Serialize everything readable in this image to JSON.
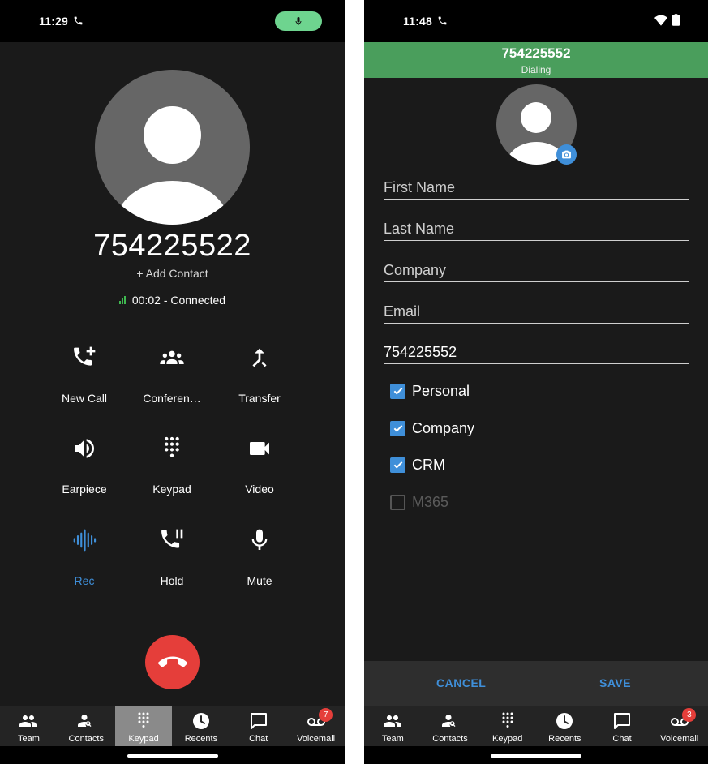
{
  "left": {
    "status_bar": {
      "time": "11:29"
    },
    "caller": {
      "number": "754225522",
      "add_contact": "+ Add Contact",
      "call_status": "00:02 - Connected"
    },
    "actions": [
      {
        "label": "New Call",
        "icon": "phone-plus-icon"
      },
      {
        "label": "Conferen…",
        "icon": "group-icon"
      },
      {
        "label": "Transfer",
        "icon": "call-merge-icon"
      },
      {
        "label": "Earpiece",
        "icon": "speaker-icon"
      },
      {
        "label": "Keypad",
        "icon": "dialpad-icon"
      },
      {
        "label": "Video",
        "icon": "video-camera-icon"
      },
      {
        "label": "Rec",
        "icon": "waveform-icon"
      },
      {
        "label": "Hold",
        "icon": "phone-pause-icon"
      },
      {
        "label": "Mute",
        "icon": "microphone-icon"
      }
    ],
    "tabs": [
      {
        "label": "Team"
      },
      {
        "label": "Contacts"
      },
      {
        "label": "Keypad"
      },
      {
        "label": "Recents"
      },
      {
        "label": "Chat"
      },
      {
        "label": "Voicemail",
        "badge": "7"
      }
    ]
  },
  "right": {
    "status_bar": {
      "time": "11:48"
    },
    "header": {
      "number": "754225552",
      "status": "Dialing"
    },
    "form": {
      "first_name": {
        "placeholder": "First Name",
        "value": ""
      },
      "last_name": {
        "placeholder": "Last Name",
        "value": ""
      },
      "company": {
        "placeholder": "Company",
        "value": ""
      },
      "email": {
        "placeholder": "Email",
        "value": ""
      },
      "phone": {
        "placeholder": "",
        "value": "754225552"
      }
    },
    "checkboxes": [
      {
        "label": "Personal",
        "checked": true
      },
      {
        "label": "Company",
        "checked": true
      },
      {
        "label": "CRM",
        "checked": true
      },
      {
        "label": "M365",
        "checked": false
      }
    ],
    "buttons": {
      "cancel": "CANCEL",
      "save": "SAVE"
    },
    "tabs": [
      {
        "label": "Team"
      },
      {
        "label": "Contacts"
      },
      {
        "label": "Keypad"
      },
      {
        "label": "Recents"
      },
      {
        "label": "Chat"
      },
      {
        "label": "Voicemail",
        "badge": "3"
      }
    ]
  },
  "colors": {
    "accent": "#3f8fd9",
    "call_green": "#4a9e5c",
    "hangup_red": "#e53e3a",
    "screen_bg": "#1a1a1a"
  }
}
